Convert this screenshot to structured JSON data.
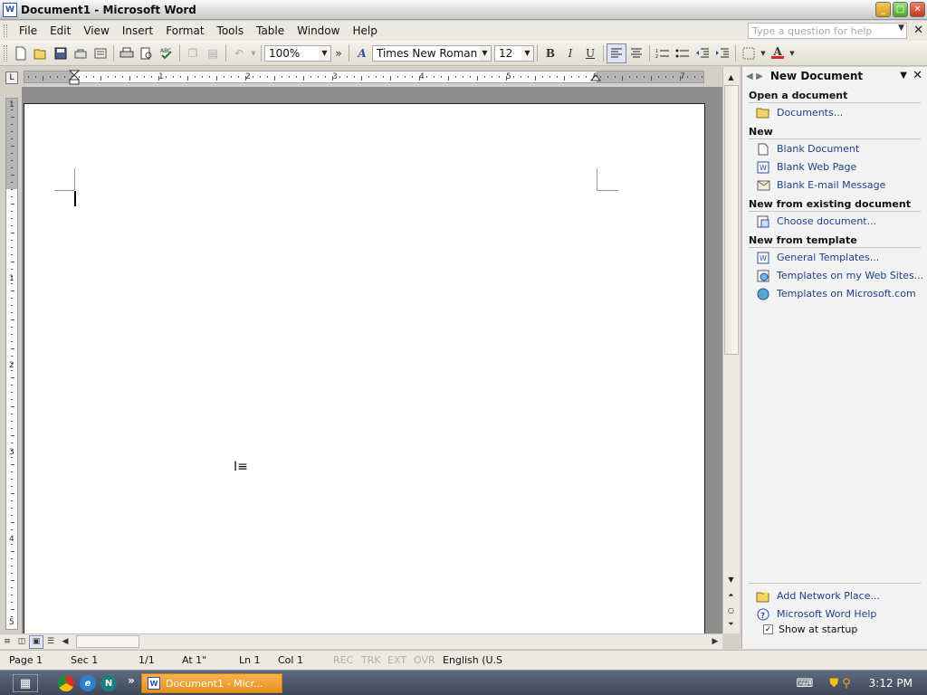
{
  "window": {
    "title": "Document1 - Microsoft Word",
    "app_icon": "W"
  },
  "menu": {
    "items": [
      "File",
      "Edit",
      "View",
      "Insert",
      "Format",
      "Tools",
      "Table",
      "Window",
      "Help"
    ],
    "help_placeholder": "Type a question for help"
  },
  "toolbar": {
    "zoom": "100%",
    "font": "Times New Roman",
    "size": "12",
    "bold": "B",
    "italic": "I",
    "underline": "U",
    "font_color": "#d9281c"
  },
  "ruler": {
    "h_numbers": [
      "1",
      "2",
      "3",
      "4",
      "5",
      "6",
      "7"
    ],
    "v_numbers": [
      "1",
      "1",
      "2",
      "3",
      "4",
      "5"
    ]
  },
  "task_pane": {
    "title": "New Document",
    "sections": [
      {
        "title": "Open a document",
        "links": [
          "Documents..."
        ]
      },
      {
        "title": "New",
        "links": [
          "Blank Document",
          "Blank Web Page",
          "Blank E-mail Message"
        ]
      },
      {
        "title": "New from existing document",
        "links": [
          "Choose document..."
        ]
      },
      {
        "title": "New from template",
        "links": [
          "General Templates...",
          "Templates on my Web Sites...",
          "Templates on Microsoft.com"
        ]
      }
    ],
    "bottom_links": [
      "Add Network Place...",
      "Microsoft Word Help"
    ],
    "show_at_startup": "Show at startup"
  },
  "status": {
    "page": "Page 1",
    "sec": "Sec 1",
    "pages": "1/1",
    "at": "At 1\"",
    "ln": "Ln 1",
    "col": "Col 1",
    "rec": "REC",
    "trk": "TRK",
    "ext": "EXT",
    "ovr": "OVR",
    "language": "English (U.S"
  },
  "taskbar": {
    "task_label": "Document1 - Micr...",
    "clock": "3:12 PM",
    "chevron": "»"
  },
  "colors": {
    "link": "#21408b",
    "taskbar_active": "#f0a43a"
  }
}
